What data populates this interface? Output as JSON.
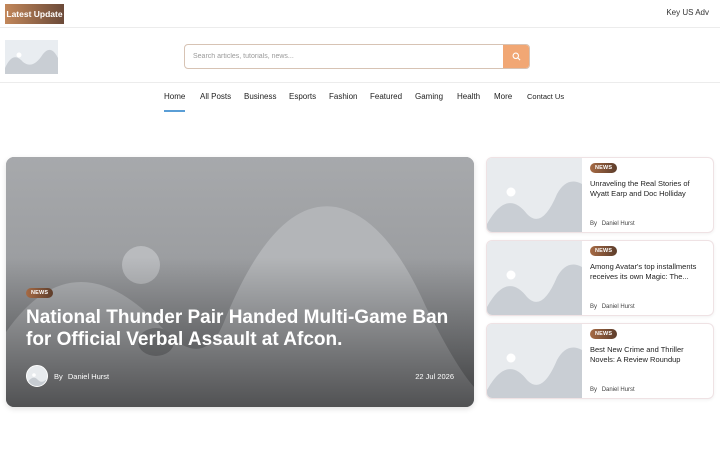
{
  "topbar": {
    "latest_label": "Latest Update",
    "ad_text": "Key US Adv"
  },
  "search": {
    "placeholder": "Search articles, tutorials, news..."
  },
  "nav": {
    "items": [
      "Home",
      "All Posts",
      "Business",
      "Esports",
      "Fashion",
      "Featured",
      "Gaming",
      "Health",
      "More",
      "Contact Us"
    ],
    "active": "Home"
  },
  "hero": {
    "badge": "NEWS",
    "title": "National Thunder Pair Handed Multi-Game Ban for Official Verbal Assault at Afcon.",
    "by_prefix": "By",
    "author": "Daniel Hurst",
    "date": "22 Jul 2026"
  },
  "side_posts": [
    {
      "badge": "NEWS",
      "title": "Unraveling the Real Stories of Wyatt Earp and Doc Holliday",
      "by_prefix": "By",
      "author": "Daniel Hurst"
    },
    {
      "badge": "NEWS",
      "title": "Among Avatar's top installments receives its own Magic: The...",
      "by_prefix": "By",
      "author": "Daniel Hurst"
    },
    {
      "badge": "NEWS",
      "title": "Best New Crime and Thriller Novels: A Review Roundup",
      "by_prefix": "By",
      "author": "Daniel Hurst"
    }
  ],
  "colors": {
    "accent": "#f1a774",
    "badge_from": "#c2875a",
    "badge_to": "#6b4a39",
    "nav_active_underline": "#5a9ed6"
  },
  "icons": {
    "search": "search-icon",
    "placeholder": "image-placeholder-icon"
  }
}
